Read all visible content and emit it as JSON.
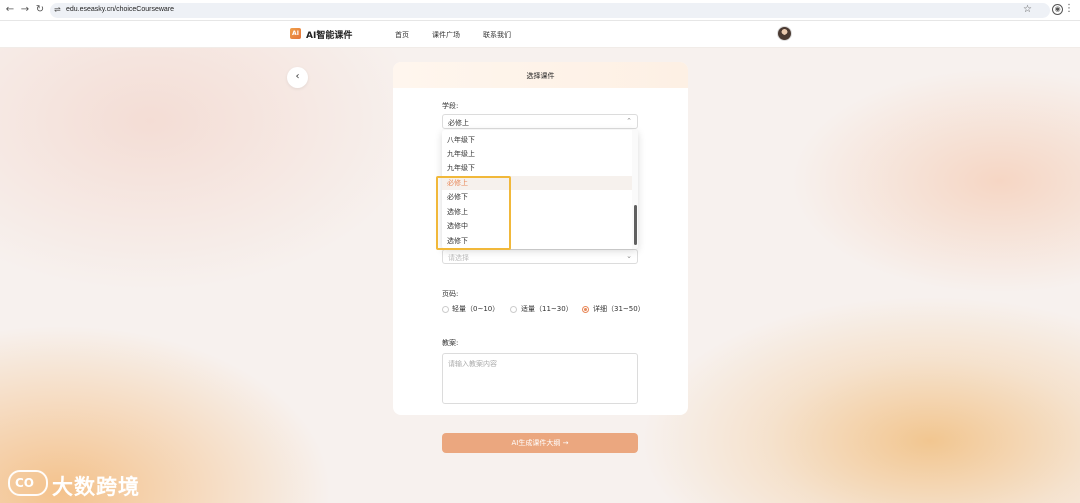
{
  "browser": {
    "url": "edu.eseasky.cn/choiceCourseware",
    "back_icon": "←",
    "forward_icon": "→",
    "reload_icon": "↻",
    "site_info_icon": "⇌",
    "star_icon": "☆",
    "profile_icon": "◉",
    "menu_icon": "⋮"
  },
  "header": {
    "logo_mark": "AI",
    "logo_text": "AI智能课件",
    "nav": [
      "首页",
      "课件广场",
      "联系我们"
    ]
  },
  "back_button_icon": "‹",
  "card": {
    "title": "选择课件",
    "stage": {
      "label": "学段:",
      "value": "必修上",
      "caret": "⌃",
      "options": [
        "八年级下",
        "九年级上",
        "九年级下",
        "必修上",
        "必修下",
        "选修上",
        "选修中",
        "选修下"
      ],
      "selected_index": 3
    },
    "hidden_select": {
      "placeholder": "请选择",
      "caret": "⌄"
    },
    "pages": {
      "label": "页码:",
      "options": [
        "轻量（0~10）",
        "适量（11~30）",
        "详细（31~50）"
      ],
      "selected_index": 2
    },
    "plan": {
      "label": "教案:",
      "placeholder": "请输入教案内容"
    }
  },
  "generate_button": "AI生成课件大纲 →",
  "watermark": {
    "logo": "CO",
    "text": "大数跨境"
  },
  "colors": {
    "accent": "#e8895a",
    "button": "#eba77f",
    "highlight": "#f1b83a"
  }
}
